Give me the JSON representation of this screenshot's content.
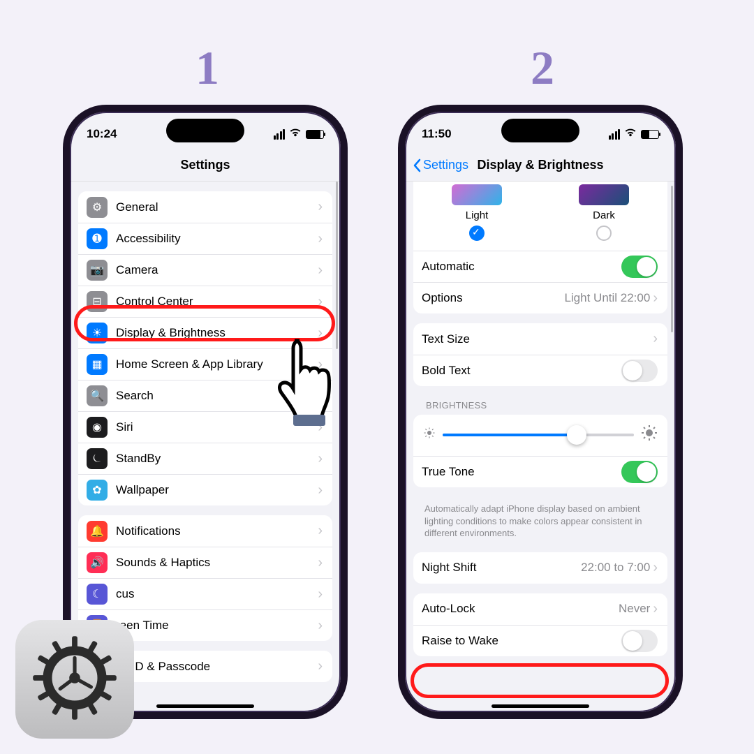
{
  "steps": {
    "one": "1",
    "two": "2"
  },
  "p1": {
    "time": "10:24",
    "title": "Settings",
    "groupA": [
      {
        "icon": "gear-icon",
        "bg": "ic-gray",
        "label": "General"
      },
      {
        "icon": "accessibility-icon",
        "bg": "ic-blue",
        "label": "Accessibility"
      },
      {
        "icon": "camera-icon",
        "bg": "ic-gray",
        "label": "Camera"
      },
      {
        "icon": "control-center-icon",
        "bg": "ic-gray",
        "label": "Control Center"
      },
      {
        "icon": "brightness-icon",
        "bg": "ic-blue",
        "label": "Display & Brightness"
      },
      {
        "icon": "home-screen-icon",
        "bg": "ic-blue",
        "label": "Home Screen & App Library"
      },
      {
        "icon": "search-icon",
        "bg": "ic-gray",
        "label": "Search"
      },
      {
        "icon": "siri-icon",
        "bg": "ic-black",
        "label": "Siri"
      },
      {
        "icon": "standby-icon",
        "bg": "ic-black",
        "label": "StandBy"
      },
      {
        "icon": "wallpaper-icon",
        "bg": "ic-cyan",
        "label": "Wallpaper"
      }
    ],
    "groupB": [
      {
        "icon": "notifications-icon",
        "bg": "ic-red",
        "label": "Notifications"
      },
      {
        "icon": "sounds-icon",
        "bg": "ic-pink",
        "label": "Sounds & Haptics"
      },
      {
        "icon": "focus-icon",
        "bg": "ic-indigo",
        "label": "cus"
      },
      {
        "icon": "screen-time-icon",
        "bg": "ic-indigo",
        "label": "reen Time"
      }
    ],
    "groupC": [
      {
        "icon": "faceid-icon",
        "bg": "ic-green",
        "label": "ce ID & Passcode"
      }
    ]
  },
  "p2": {
    "time": "11:50",
    "back": "Settings",
    "title": "Display & Brightness",
    "appearance": {
      "light": "Light",
      "dark": "Dark"
    },
    "automatic": "Automatic",
    "options_label": "Options",
    "options_value": "Light Until 22:00",
    "text_size": "Text Size",
    "bold_text": "Bold Text",
    "brightness_hdr": "BRIGHTNESS",
    "true_tone": "True Tone",
    "tt_note": "Automatically adapt iPhone display based on ambient lighting conditions to make colors appear consistent in different environments.",
    "night_shift": "Night Shift",
    "night_shift_value": "22:00 to 7:00",
    "auto_lock": "Auto-Lock",
    "auto_lock_value": "Never",
    "raise_to_wake": "Raise to Wake"
  }
}
